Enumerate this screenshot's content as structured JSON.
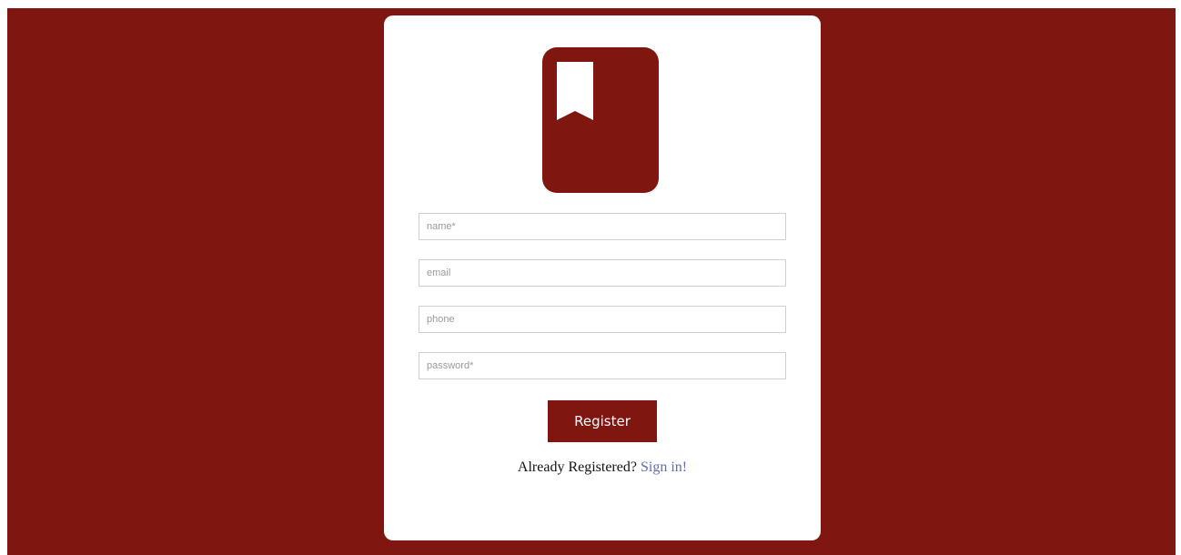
{
  "colors": {
    "brand": "#7f1710",
    "card": "#ffffff",
    "link": "#5b6fb0",
    "input_border": "#cfcfcf"
  },
  "logo": {
    "icon": "bookmark-book-icon"
  },
  "form": {
    "fields": [
      {
        "name": "name",
        "placeholder": "name*",
        "value": ""
      },
      {
        "name": "email",
        "placeholder": "email",
        "value": ""
      },
      {
        "name": "phone",
        "placeholder": "phone",
        "value": ""
      },
      {
        "name": "password",
        "placeholder": "password*",
        "value": ""
      }
    ],
    "register_label": "Register"
  },
  "footer": {
    "prompt": "Already Registered?",
    "link_label": "Sign in!"
  }
}
